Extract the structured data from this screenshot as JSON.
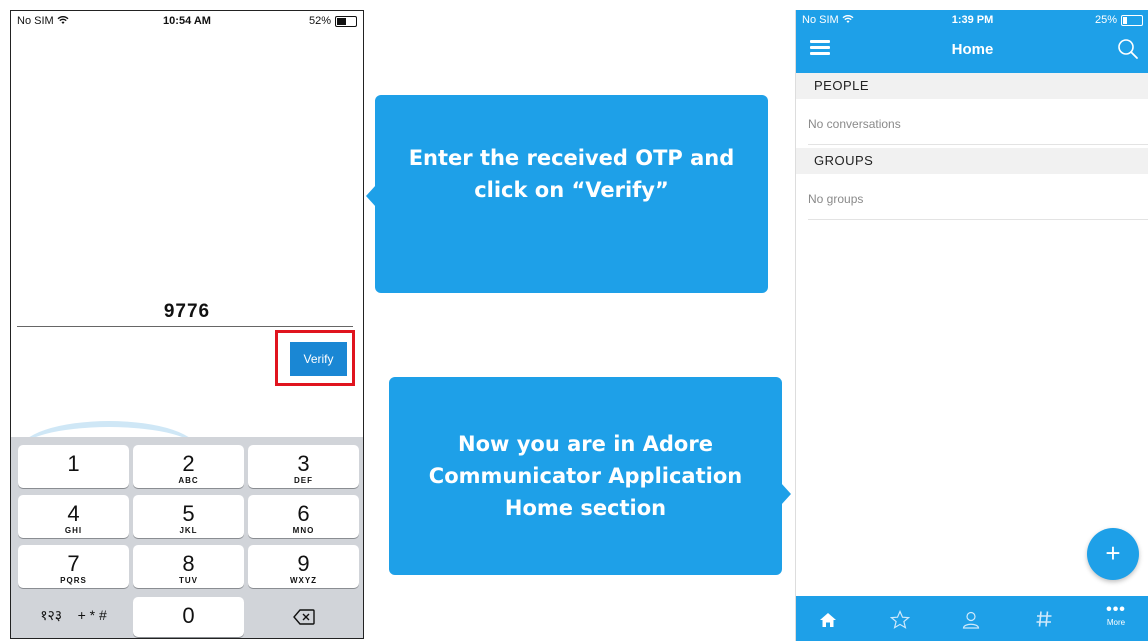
{
  "left_phone": {
    "status": {
      "carrier": "No SIM",
      "time": "10:54 AM",
      "battery": "52%",
      "battery_level": 0.52
    },
    "otp_value": "9776",
    "verify_label": "Verify",
    "keypad": [
      {
        "num": "1",
        "letters": ""
      },
      {
        "num": "2",
        "letters": "ABC"
      },
      {
        "num": "3",
        "letters": "DEF"
      },
      {
        "num": "4",
        "letters": "GHI"
      },
      {
        "num": "5",
        "letters": "JKL"
      },
      {
        "num": "6",
        "letters": "MNO"
      },
      {
        "num": "7",
        "letters": "PQRS"
      },
      {
        "num": "8",
        "letters": "TUV"
      },
      {
        "num": "9",
        "letters": "WXYZ"
      }
    ],
    "keypad_bottom": {
      "lang": "१२३",
      "symbols": "+ * #",
      "zero": "0"
    }
  },
  "callouts": {
    "first": "Enter the received OTP and click on “Verify”",
    "second": "Now you are in Adore Communicator Application Home section"
  },
  "right_phone": {
    "status": {
      "carrier": "No SIM",
      "time": "1:39 PM",
      "battery": "25%",
      "battery_level": 0.25
    },
    "title": "Home",
    "sections": [
      {
        "heading": "PEOPLE",
        "empty_text": "No conversations"
      },
      {
        "heading": "GROUPS",
        "empty_text": "No groups"
      }
    ],
    "fab_label": "+",
    "tabs": {
      "more_label": "More"
    },
    "colors": {
      "accent": "#1ea0e8",
      "highlight": "#e0141e",
      "verify_button": "#1a87d4"
    }
  }
}
